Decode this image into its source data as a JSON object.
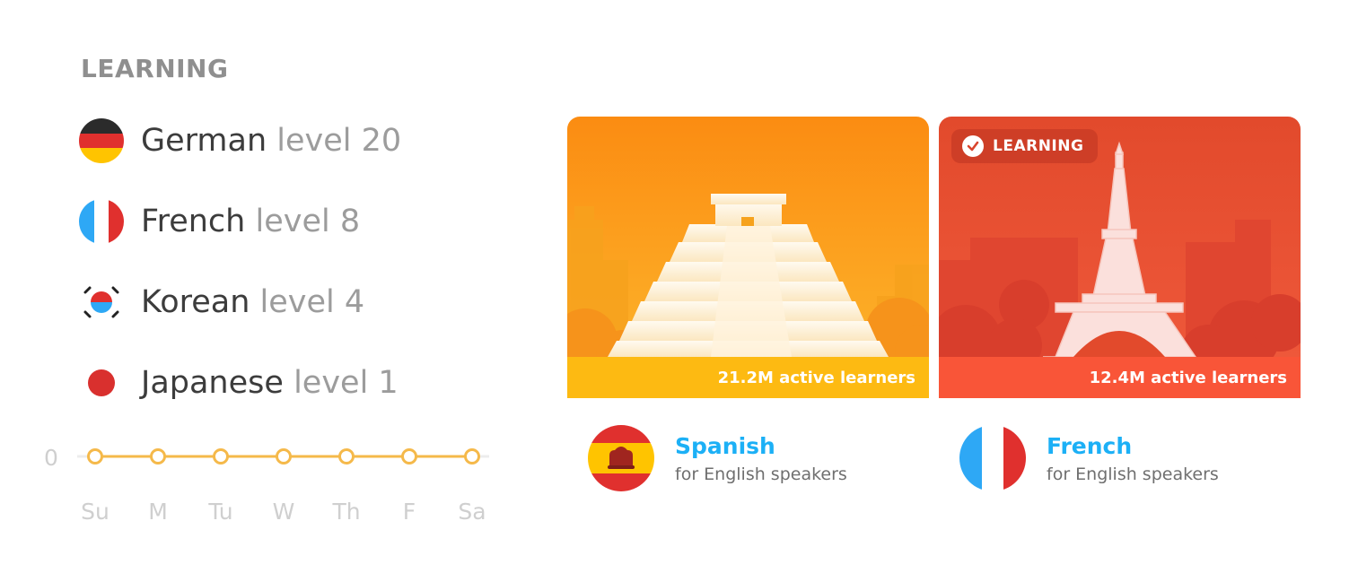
{
  "learning": {
    "heading": "LEARNING",
    "languages": [
      {
        "name": "German",
        "level": "level 20",
        "flag": "germany-flag-icon"
      },
      {
        "name": "French",
        "level": "level 8",
        "flag": "france-flag-icon"
      },
      {
        "name": "Korean",
        "level": "level 4",
        "flag": "south-korea-flag-icon"
      },
      {
        "name": "Japanese",
        "level": "level 1",
        "flag": "japan-flag-icon"
      }
    ]
  },
  "chart_data": {
    "type": "line",
    "categories": [
      "Su",
      "M",
      "Tu",
      "W",
      "Th",
      "F",
      "Sa"
    ],
    "series": [
      {
        "values": [
          0,
          0,
          0,
          0,
          0,
          0,
          0
        ]
      }
    ],
    "y_tick_labels": [
      "0"
    ],
    "grid": false
  },
  "courses": [
    {
      "name": "Spanish",
      "subtitle": "for English speakers",
      "learners": "21.2M active learners",
      "flag": "spain-flag-icon",
      "landmark": "pyramid-illustration"
    },
    {
      "name": "French",
      "subtitle": "for English speakers",
      "learners": "12.4M active learners",
      "flag": "france-flag-icon",
      "landmark": "eiffel-tower-illustration",
      "badge": "LEARNING"
    }
  ],
  "colors": {
    "accent_blue": "#1cb0f6",
    "chart_orange": "#f5b94a",
    "spanish_card": "#fba31c",
    "french_card": "#ea4f34"
  }
}
